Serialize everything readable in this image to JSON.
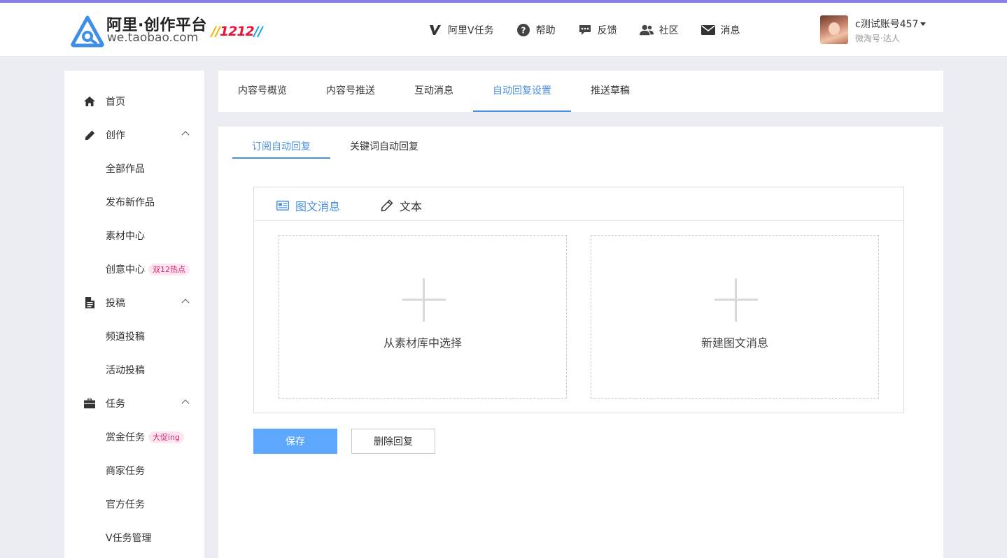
{
  "colors": {
    "accent": "#4a90e2",
    "top_line": "#8a7fe8",
    "primary_button": "#5ea7ff",
    "badge_text": "#e0206f",
    "badge_bg": "#fde6ef"
  },
  "header": {
    "logo_title": "阿里·创作平台",
    "logo_subtitle": "we.taobao.com",
    "promo_badge": {
      "parts": [
        "//",
        "1212",
        "//"
      ],
      "icon": "promo-1212-icon"
    },
    "nav": [
      {
        "label": "阿里V任务",
        "icon": "v-task-icon"
      },
      {
        "label": "帮助",
        "icon": "help-icon"
      },
      {
        "label": "反馈",
        "icon": "feedback-icon"
      },
      {
        "label": "社区",
        "icon": "community-icon"
      },
      {
        "label": "消息",
        "icon": "message-icon"
      }
    ],
    "user": {
      "name": "c测试账号457",
      "role": "微淘号·达人",
      "icon": "caret-down-icon"
    }
  },
  "sidebar": {
    "items": [
      {
        "label": "首页",
        "icon": "home-icon"
      },
      {
        "label": "创作",
        "icon": "pencil-icon",
        "expanded": true
      },
      {
        "label": "全部作品"
      },
      {
        "label": "发布新作品"
      },
      {
        "label": "素材中心"
      },
      {
        "label": "创意中心",
        "badge": "双12热点"
      },
      {
        "label": "投稿",
        "icon": "document-icon",
        "expanded": true
      },
      {
        "label": "频道投稿"
      },
      {
        "label": "活动投稿"
      },
      {
        "label": "任务",
        "icon": "briefcase-icon",
        "expanded": true
      },
      {
        "label": "赏金任务",
        "badge": "大促ing"
      },
      {
        "label": "商家任务"
      },
      {
        "label": "官方任务"
      },
      {
        "label": "V任务管理"
      }
    ]
  },
  "tabs": [
    {
      "label": "内容号概览"
    },
    {
      "label": "内容号推送"
    },
    {
      "label": "互动消息"
    },
    {
      "label": "自动回复设置",
      "active": true
    },
    {
      "label": "推送草稿"
    }
  ],
  "subtabs": [
    {
      "label": "订阅自动回复",
      "active": true
    },
    {
      "label": "关键词自动回复"
    }
  ],
  "editor": {
    "tabs": [
      {
        "label": "图文消息",
        "icon": "news-card-icon",
        "active": true
      },
      {
        "label": "文本",
        "icon": "pencil-outline-icon"
      }
    ],
    "options": [
      {
        "label": "从素材库中选择",
        "icon": "plus-icon"
      },
      {
        "label": "新建图文消息",
        "icon": "plus-icon"
      }
    ]
  },
  "actions": {
    "save_label": "保存",
    "delete_label": "删除回复"
  }
}
